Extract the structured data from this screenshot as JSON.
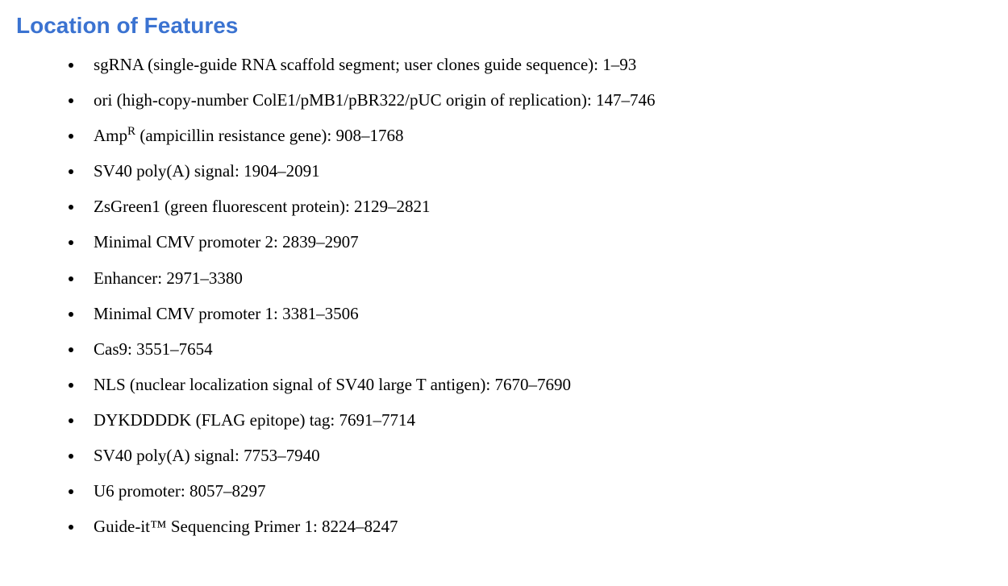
{
  "heading": "Location of Features",
  "features": [
    {
      "name_html": "sgRNA (single-guide RNA scaffold segment; user clones guide sequence)",
      "range": "1–93"
    },
    {
      "name_html": "ori (high-copy-number ColE1/pMB1/pBR322/pUC origin of replication)",
      "range": "147–746"
    },
    {
      "name_html": "Amp<span class=\"sup\">R</span> (ampicillin resistance gene)",
      "range": "908–1768"
    },
    {
      "name_html": "SV40 poly(A) signal",
      "range": "1904–2091"
    },
    {
      "name_html": "ZsGreen1 (green fluorescent protein)",
      "range": "2129–2821"
    },
    {
      "name_html": "Minimal CMV promoter 2",
      "range": "2839–2907"
    },
    {
      "name_html": "Enhancer",
      "range": "2971–3380"
    },
    {
      "name_html": "Minimal CMV promoter 1",
      "range": "3381–3506"
    },
    {
      "name_html": "Cas9",
      "range": "3551–7654"
    },
    {
      "name_html": "NLS (nuclear localization signal of SV40 large T antigen)",
      "range": "7670–7690"
    },
    {
      "name_html": "DYKDDDDK (FLAG epitope) tag",
      "range": "7691–7714"
    },
    {
      "name_html": "SV40 poly(A) signal",
      "range": "7753–7940"
    },
    {
      "name_html": "U6 promoter",
      "range": "8057–8297"
    },
    {
      "name_html": "Guide-it™ Sequencing Primer 1",
      "range": "8224–8247"
    }
  ]
}
